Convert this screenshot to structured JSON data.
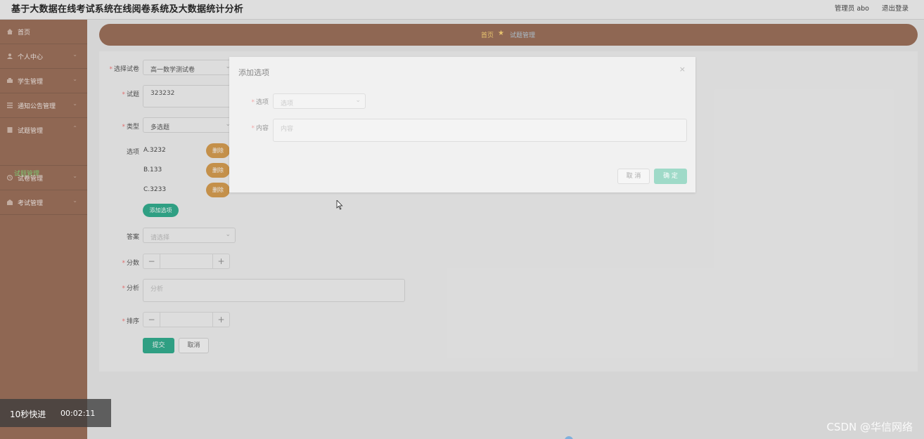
{
  "header": {
    "title": "基于大数据在线考试系统在线阅卷系统及大数据统计分析",
    "user": "管理员 abo",
    "logout": "退出登录"
  },
  "sidebar": {
    "items": [
      {
        "label": "首页"
      },
      {
        "label": "个人中心"
      },
      {
        "label": "学生管理"
      },
      {
        "label": "通知公告管理"
      },
      {
        "label": "试题管理"
      },
      {
        "label": "试卷管理"
      },
      {
        "label": "考试管理"
      }
    ],
    "active_sub": "试题管理"
  },
  "breadcrumb": {
    "home": "首页",
    "current": "试题管理"
  },
  "form": {
    "paper": {
      "label": "选择试卷",
      "value": "高一数学测试卷"
    },
    "question": {
      "label": "试题",
      "value": "323232"
    },
    "type": {
      "label": "类型",
      "value": "多选题"
    },
    "options_label": "选项",
    "options": [
      {
        "text": "A.3232",
        "delete": "删除"
      },
      {
        "text": "B.133",
        "delete": "删除"
      },
      {
        "text": "C.3233",
        "delete": "删除"
      }
    ],
    "add_option": "添加选项",
    "answer": {
      "label": "答案",
      "placeholder": "请选择"
    },
    "score": {
      "label": "分数",
      "minus": "−",
      "plus": "+"
    },
    "analysis": {
      "label": "分析",
      "placeholder": "分析"
    },
    "order": {
      "label": "排序",
      "minus": "−",
      "plus": "+"
    },
    "submit": "提交",
    "cancel": "取消"
  },
  "dialog": {
    "title": "添加选项",
    "close": "×",
    "option": {
      "label": "选项",
      "placeholder": "选项"
    },
    "content": {
      "label": "内容",
      "placeholder": "内容"
    },
    "cancel": "取 消",
    "confirm": "确 定"
  },
  "video_overlay": {
    "speed": "10秒快进",
    "time": "00:02:11"
  },
  "watermark": "CSDN @华信网络",
  "colors": {
    "sidebar": "#93624a",
    "accent_green": "#1ea784",
    "delete_orange": "#d4943f",
    "breadcrumb_home": "#ffd36b"
  }
}
